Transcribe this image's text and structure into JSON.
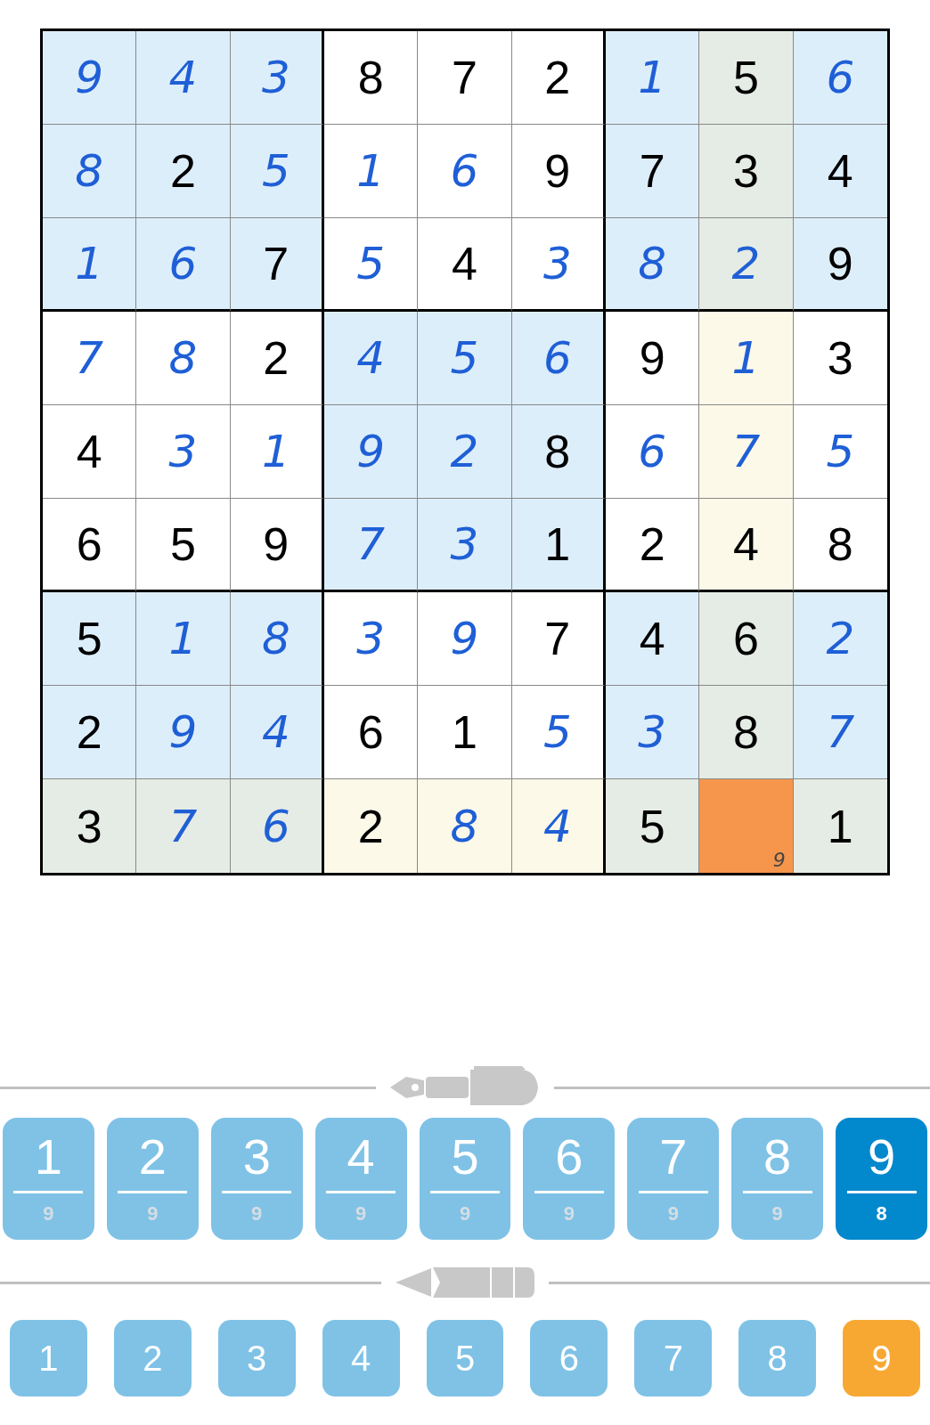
{
  "grid": {
    "rows": [
      [
        {
          "value": "9",
          "kind": "entered",
          "selected": false,
          "highlighted": false
        },
        {
          "value": "4",
          "kind": "entered",
          "selected": false,
          "highlighted": false
        },
        {
          "value": "3",
          "kind": "entered",
          "selected": false,
          "highlighted": false
        },
        {
          "value": "8",
          "kind": "given",
          "selected": false,
          "highlighted": false
        },
        {
          "value": "7",
          "kind": "given",
          "selected": false,
          "highlighted": false
        },
        {
          "value": "2",
          "kind": "given",
          "selected": false,
          "highlighted": false
        },
        {
          "value": "1",
          "kind": "entered",
          "selected": false,
          "highlighted": false
        },
        {
          "value": "5",
          "kind": "given",
          "selected": false,
          "highlighted": true
        },
        {
          "value": "6",
          "kind": "entered",
          "selected": false,
          "highlighted": false
        }
      ],
      [
        {
          "value": "8",
          "kind": "entered",
          "selected": false,
          "highlighted": false
        },
        {
          "value": "2",
          "kind": "given",
          "selected": false,
          "highlighted": false
        },
        {
          "value": "5",
          "kind": "entered",
          "selected": false,
          "highlighted": false
        },
        {
          "value": "1",
          "kind": "entered",
          "selected": false,
          "highlighted": false
        },
        {
          "value": "6",
          "kind": "entered",
          "selected": false,
          "highlighted": false
        },
        {
          "value": "9",
          "kind": "given",
          "selected": false,
          "highlighted": false
        },
        {
          "value": "7",
          "kind": "given",
          "selected": false,
          "highlighted": false
        },
        {
          "value": "3",
          "kind": "given",
          "selected": false,
          "highlighted": true
        },
        {
          "value": "4",
          "kind": "given",
          "selected": false,
          "highlighted": false
        }
      ],
      [
        {
          "value": "1",
          "kind": "entered",
          "selected": false,
          "highlighted": false
        },
        {
          "value": "6",
          "kind": "entered",
          "selected": false,
          "highlighted": false
        },
        {
          "value": "7",
          "kind": "given",
          "selected": false,
          "highlighted": false
        },
        {
          "value": "5",
          "kind": "entered",
          "selected": false,
          "highlighted": false
        },
        {
          "value": "4",
          "kind": "given",
          "selected": false,
          "highlighted": false
        },
        {
          "value": "3",
          "kind": "entered",
          "selected": false,
          "highlighted": false
        },
        {
          "value": "8",
          "kind": "entered",
          "selected": false,
          "highlighted": false
        },
        {
          "value": "2",
          "kind": "entered",
          "selected": false,
          "highlighted": true
        },
        {
          "value": "9",
          "kind": "given",
          "selected": false,
          "highlighted": false
        }
      ],
      [
        {
          "value": "7",
          "kind": "entered",
          "selected": false,
          "highlighted": false
        },
        {
          "value": "8",
          "kind": "entered",
          "selected": false,
          "highlighted": false
        },
        {
          "value": "2",
          "kind": "given",
          "selected": false,
          "highlighted": false
        },
        {
          "value": "4",
          "kind": "entered",
          "selected": false,
          "highlighted": false
        },
        {
          "value": "5",
          "kind": "entered",
          "selected": false,
          "highlighted": false
        },
        {
          "value": "6",
          "kind": "entered",
          "selected": false,
          "highlighted": false
        },
        {
          "value": "9",
          "kind": "given",
          "selected": false,
          "highlighted": false
        },
        {
          "value": "1",
          "kind": "entered",
          "selected": false,
          "highlighted": true
        },
        {
          "value": "3",
          "kind": "given",
          "selected": false,
          "highlighted": false
        }
      ],
      [
        {
          "value": "4",
          "kind": "given",
          "selected": false,
          "highlighted": false
        },
        {
          "value": "3",
          "kind": "entered",
          "selected": false,
          "highlighted": false
        },
        {
          "value": "1",
          "kind": "entered",
          "selected": false,
          "highlighted": false
        },
        {
          "value": "9",
          "kind": "entered",
          "selected": false,
          "highlighted": false
        },
        {
          "value": "2",
          "kind": "entered",
          "selected": false,
          "highlighted": false
        },
        {
          "value": "8",
          "kind": "given",
          "selected": false,
          "highlighted": false
        },
        {
          "value": "6",
          "kind": "entered",
          "selected": false,
          "highlighted": false
        },
        {
          "value": "7",
          "kind": "entered",
          "selected": false,
          "highlighted": true
        },
        {
          "value": "5",
          "kind": "entered",
          "selected": false,
          "highlighted": false
        }
      ],
      [
        {
          "value": "6",
          "kind": "given",
          "selected": false,
          "highlighted": false
        },
        {
          "value": "5",
          "kind": "given",
          "selected": false,
          "highlighted": false
        },
        {
          "value": "9",
          "kind": "given",
          "selected": false,
          "highlighted": false
        },
        {
          "value": "7",
          "kind": "entered",
          "selected": false,
          "highlighted": false
        },
        {
          "value": "3",
          "kind": "entered",
          "selected": false,
          "highlighted": false
        },
        {
          "value": "1",
          "kind": "given",
          "selected": false,
          "highlighted": false
        },
        {
          "value": "2",
          "kind": "given",
          "selected": false,
          "highlighted": false
        },
        {
          "value": "4",
          "kind": "given",
          "selected": false,
          "highlighted": true
        },
        {
          "value": "8",
          "kind": "given",
          "selected": false,
          "highlighted": false
        }
      ],
      [
        {
          "value": "5",
          "kind": "given",
          "selected": false,
          "highlighted": false
        },
        {
          "value": "1",
          "kind": "entered",
          "selected": false,
          "highlighted": false
        },
        {
          "value": "8",
          "kind": "entered",
          "selected": false,
          "highlighted": false
        },
        {
          "value": "3",
          "kind": "entered",
          "selected": false,
          "highlighted": false
        },
        {
          "value": "9",
          "kind": "entered",
          "selected": false,
          "highlighted": false
        },
        {
          "value": "7",
          "kind": "given",
          "selected": false,
          "highlighted": false
        },
        {
          "value": "4",
          "kind": "given",
          "selected": false,
          "highlighted": false
        },
        {
          "value": "6",
          "kind": "given",
          "selected": false,
          "highlighted": true
        },
        {
          "value": "2",
          "kind": "entered",
          "selected": false,
          "highlighted": false
        }
      ],
      [
        {
          "value": "2",
          "kind": "given",
          "selected": false,
          "highlighted": false
        },
        {
          "value": "9",
          "kind": "entered",
          "selected": false,
          "highlighted": false
        },
        {
          "value": "4",
          "kind": "entered",
          "selected": false,
          "highlighted": false
        },
        {
          "value": "6",
          "kind": "given",
          "selected": false,
          "highlighted": false
        },
        {
          "value": "1",
          "kind": "given",
          "selected": false,
          "highlighted": false
        },
        {
          "value": "5",
          "kind": "entered",
          "selected": false,
          "highlighted": false
        },
        {
          "value": "3",
          "kind": "entered",
          "selected": false,
          "highlighted": false
        },
        {
          "value": "8",
          "kind": "given",
          "selected": false,
          "highlighted": true
        },
        {
          "value": "7",
          "kind": "entered",
          "selected": false,
          "highlighted": false
        }
      ],
      [
        {
          "value": "3",
          "kind": "given",
          "selected": false,
          "highlighted": true
        },
        {
          "value": "7",
          "kind": "entered",
          "selected": false,
          "highlighted": true
        },
        {
          "value": "6",
          "kind": "entered",
          "selected": false,
          "highlighted": true
        },
        {
          "value": "2",
          "kind": "given",
          "selected": false,
          "highlighted": true
        },
        {
          "value": "8",
          "kind": "entered",
          "selected": false,
          "highlighted": true
        },
        {
          "value": "4",
          "kind": "entered",
          "selected": false,
          "highlighted": true
        },
        {
          "value": "5",
          "kind": "given",
          "selected": false,
          "highlighted": true
        },
        {
          "kind": "empty",
          "notes": [
            "9"
          ],
          "selected": true
        },
        {
          "value": "1",
          "kind": "given",
          "selected": false,
          "highlighted": true
        }
      ]
    ]
  },
  "pen_pad": {
    "buttons": [
      {
        "digit": "1",
        "count": "9",
        "selected": false
      },
      {
        "digit": "2",
        "count": "9",
        "selected": false
      },
      {
        "digit": "3",
        "count": "9",
        "selected": false
      },
      {
        "digit": "4",
        "count": "9",
        "selected": false
      },
      {
        "digit": "5",
        "count": "9",
        "selected": false
      },
      {
        "digit": "6",
        "count": "9",
        "selected": false
      },
      {
        "digit": "7",
        "count": "9",
        "selected": false
      },
      {
        "digit": "8",
        "count": "9",
        "selected": false
      },
      {
        "digit": "9",
        "count": "8",
        "selected": true
      }
    ]
  },
  "pencil_pad": {
    "buttons": [
      {
        "digit": "1",
        "selected": false
      },
      {
        "digit": "2",
        "selected": false
      },
      {
        "digit": "3",
        "selected": false
      },
      {
        "digit": "4",
        "selected": false
      },
      {
        "digit": "5",
        "selected": false
      },
      {
        "digit": "6",
        "selected": false
      },
      {
        "digit": "7",
        "selected": false
      },
      {
        "digit": "8",
        "selected": false
      },
      {
        "digit": "9",
        "selected": true
      }
    ]
  }
}
